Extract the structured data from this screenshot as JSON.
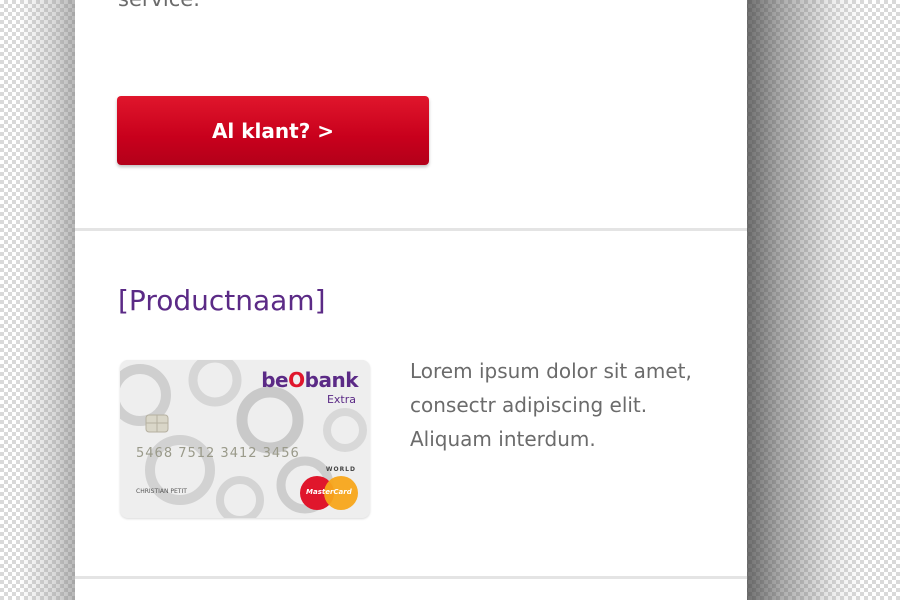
{
  "intro": {
    "text": "service."
  },
  "cta": {
    "label": "Al klant? >"
  },
  "product": {
    "title": "[Productnaam]",
    "description": "Lorem ipsum dolor sit amet, consectr adipiscing elit. Aliquam interdum.",
    "card": {
      "brand_prefix": "be",
      "brand_o": "O",
      "brand_suffix": "bank",
      "tier": "Extra",
      "number": "5468  7512  3412  3456",
      "world": "WORLD",
      "holder": "CHRISTIAN PETIT",
      "network": "MasterCard"
    }
  },
  "colors": {
    "accent_red": "#c8001c",
    "brand_purple": "#5b2a86",
    "body_text": "#6b6b6b",
    "divider": "#e4e4e4"
  }
}
